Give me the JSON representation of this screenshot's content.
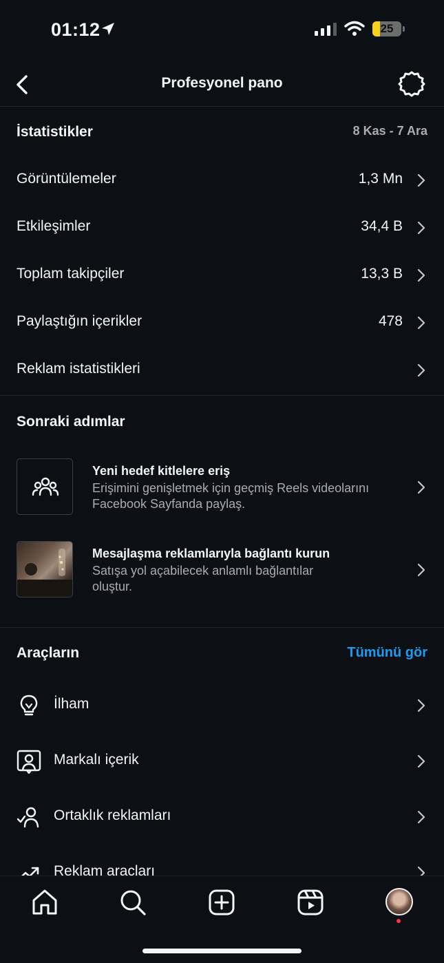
{
  "status": {
    "time": "01:12",
    "battery": "25"
  },
  "nav": {
    "title": "Profesyonel pano",
    "back_icon": "chevron-left-icon",
    "settings_icon": "gear-icon"
  },
  "stats": {
    "title": "İstatistikler",
    "date_range": "8 Kas - 7 Ara",
    "rows": [
      {
        "label": "Görüntülemeler",
        "value": "1,3 Mn"
      },
      {
        "label": "Etkileşimler",
        "value": "34,4 B"
      },
      {
        "label": "Toplam takipçiler",
        "value": "13,3 B"
      },
      {
        "label": "Paylaştığın içerikler",
        "value": "478"
      },
      {
        "label": "Reklam istatistikleri",
        "value": ""
      }
    ]
  },
  "next_steps": {
    "title": "Sonraki adımlar",
    "items": [
      {
        "title": "Yeni hedef kitlelere eriş",
        "desc": "Erişimini genişletmek için geçmiş Reels videolarını Facebook Sayfanda paylaş.",
        "icon": "audience-icon"
      },
      {
        "title": "Mesajlaşma reklamlarıyla bağlantı kurun",
        "desc": "Satışa yol açabilecek anlamlı bağlantılar oluştur.",
        "icon": "photo-thumbnail"
      }
    ]
  },
  "tools": {
    "title": "Araçların",
    "see_all": "Tümünü gör",
    "items": [
      {
        "label": "İlham",
        "icon": "lightbulb-icon"
      },
      {
        "label": "Markalı içerik",
        "icon": "branded-content-icon"
      },
      {
        "label": "Ortaklık reklamları",
        "icon": "partnership-icon"
      },
      {
        "label": "Reklam araçları",
        "icon": "trending-icon"
      }
    ]
  },
  "tabbar": [
    "home-icon",
    "search-icon",
    "create-icon",
    "reels-icon",
    "profile-avatar"
  ],
  "colors": {
    "background": "#0c0f14",
    "accent": "#1d9bf0",
    "muted": "#a9acb1"
  }
}
